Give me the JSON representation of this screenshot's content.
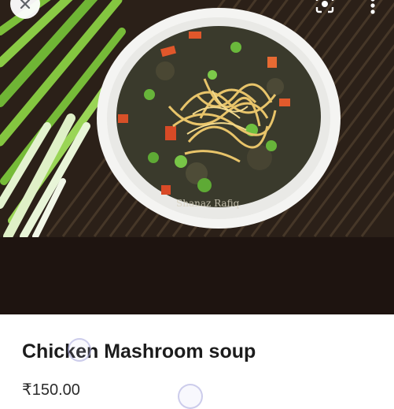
{
  "product": {
    "title": "Chicken Mashroom soup",
    "price": "₹150.00",
    "image": {
      "subject": "photo",
      "watermark": "Shanaz Rafiq"
    }
  },
  "toolbar": {
    "close_icon": "close-icon",
    "lens_icon": "lens-icon",
    "more_icon": "more-vert-icon"
  },
  "colors": {
    "sheet_background": "#ffffff",
    "band": "#1e1410",
    "text_primary": "#1c1c1c"
  }
}
